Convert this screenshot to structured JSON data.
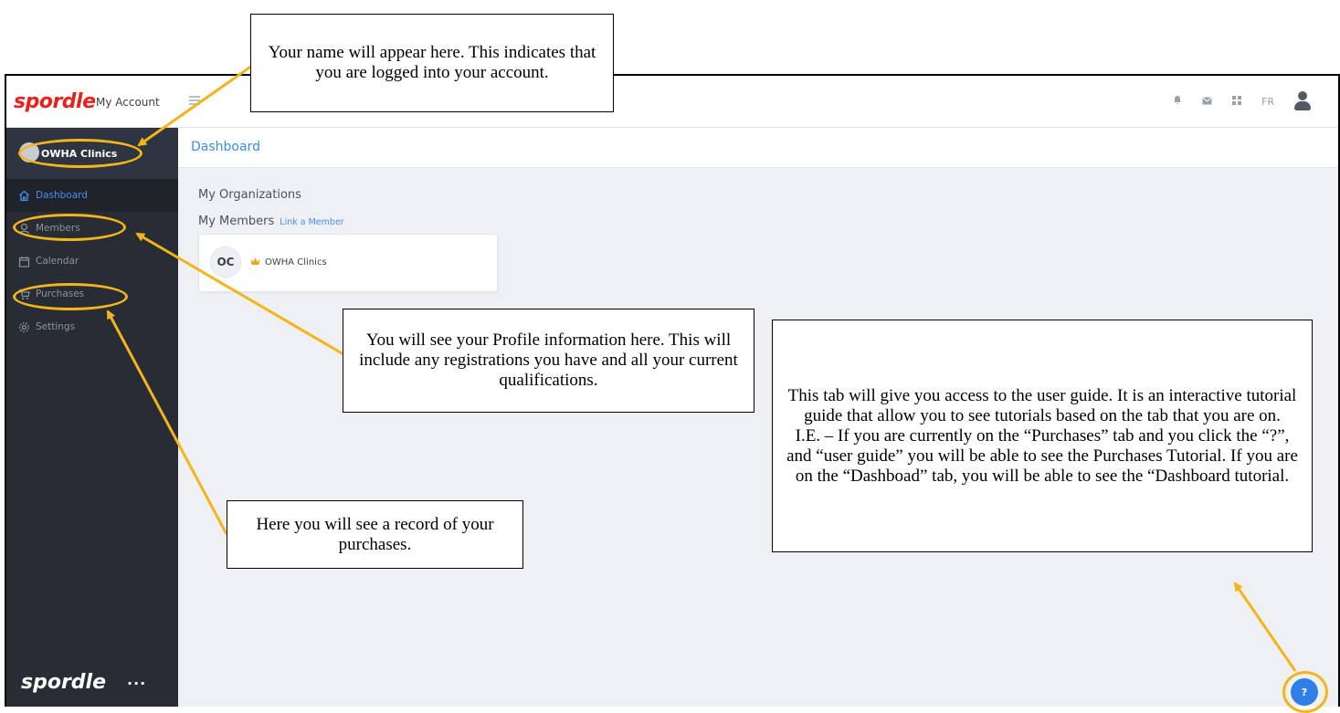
{
  "app": {
    "brand": "spordle",
    "section": "My Account",
    "lang_toggle": "FR"
  },
  "topbar": {
    "icons": [
      "bell-icon",
      "mail-icon",
      "apps-grid-icon",
      "user-avatar-icon"
    ]
  },
  "sidebar": {
    "org_name": "OWHA Clinics",
    "items": [
      {
        "label": "Dashboard",
        "icon": "home-icon",
        "active": true
      },
      {
        "label": "Members",
        "icon": "user-icon",
        "active": false
      },
      {
        "label": "Calendar",
        "icon": "calendar-icon",
        "active": false
      },
      {
        "label": "Purchases",
        "icon": "cart-icon",
        "active": false
      },
      {
        "label": "Settings",
        "icon": "gear-icon",
        "active": false
      }
    ],
    "footer_brand": "spordle",
    "more_label": "···"
  },
  "page": {
    "title": "Dashboard",
    "my_organizations": "My Organizations",
    "my_members": "My Members",
    "link_member": "Link a Member",
    "member_card": {
      "initials": "OC",
      "name": "OWHA Clinics"
    }
  },
  "help": {
    "label": "?"
  },
  "annotations": {
    "name_note": "Your name will appear here. This indicates that you are logged into your account.",
    "profile_note": "You will see your Profile information here. This will include any registrations you have and all your current qualifications.",
    "purchases_note": "Here you will see a record of your purchases.",
    "help_note_lines": [
      "This tab will give you access to the user guide. It is an interactive tutorial guide that allow you to see tutorials based on the tab that you are on.",
      "I.E. – If you are currently on the “Purchases” tab and you click the “?”, and “user guide” you will be able to see the Purchases Tutorial. If you are on the “Dashboad” tab, you will be able to see the “Dashboard tutorial."
    ],
    "accent_color": "#f4b51a"
  }
}
